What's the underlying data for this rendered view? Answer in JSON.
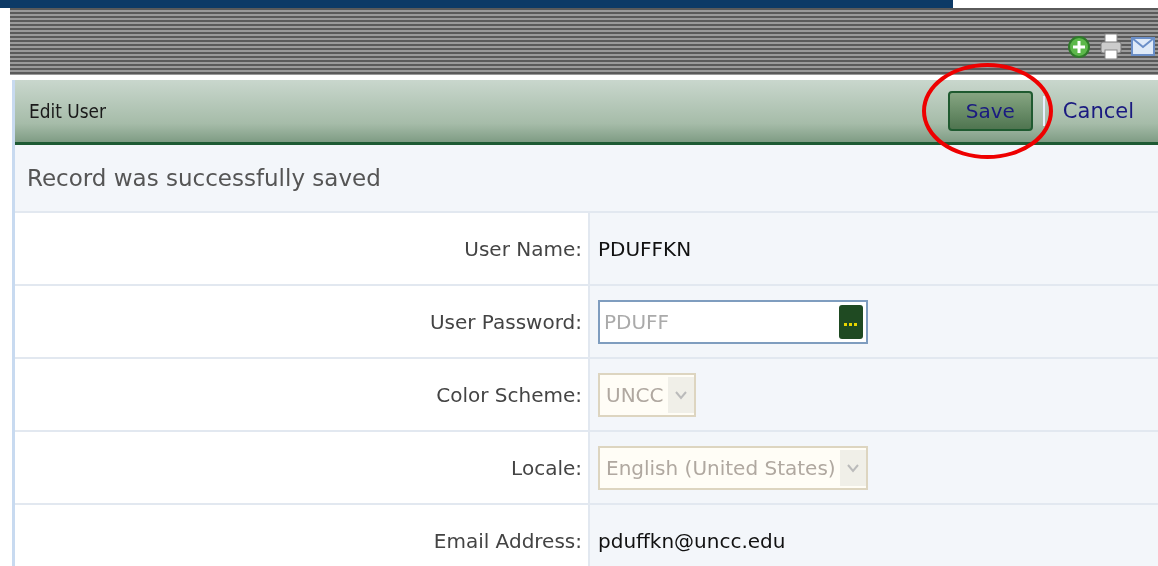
{
  "header": {
    "title": "Edit User",
    "buttons": [
      {
        "label": "Save",
        "kind": "button",
        "highlighted": true
      },
      {
        "label": "Cancel",
        "kind": "link"
      }
    ]
  },
  "message": "Record was successfully saved",
  "fields": [
    {
      "label": "User Name:",
      "kind": "text",
      "value": "PDUFFKN"
    },
    {
      "label": "User Password:",
      "kind": "password",
      "placeholder": "PDUFF"
    },
    {
      "label": "Color Scheme:",
      "kind": "select",
      "value": "UNCC",
      "disabled": true
    },
    {
      "label": "Locale:",
      "kind": "select",
      "value": "English (United States)",
      "disabled": true
    },
    {
      "label": "Email Address:",
      "kind": "text",
      "value": "pduffkn@uncc.edu"
    }
  ]
}
